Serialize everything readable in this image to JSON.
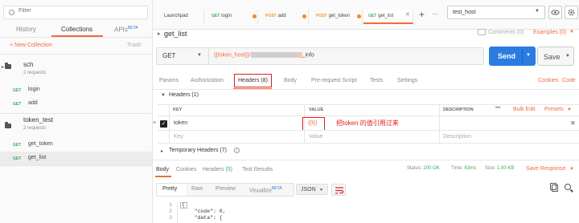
{
  "sidebar": {
    "filter_placeholder": "Filter",
    "tabs": [
      {
        "label": "History"
      },
      {
        "label": "Collections"
      },
      {
        "label": "APIs"
      }
    ],
    "apis_badge": "BETA",
    "new_collection": "+ New Collection",
    "trash": "Trash",
    "collections": [
      {
        "name": "sch",
        "count": "2 requests",
        "requests": [
          {
            "method": "GET",
            "name": "login"
          },
          {
            "method": "GET",
            "name": "add"
          }
        ]
      },
      {
        "name": "token_test",
        "count": "2 requests",
        "requests": [
          {
            "method": "GET",
            "name": "get_token"
          },
          {
            "method": "GET",
            "name": "get_list"
          }
        ]
      }
    ]
  },
  "tabs": [
    {
      "label": "Launchpad",
      "method": ""
    },
    {
      "label": "login",
      "method": "GET"
    },
    {
      "label": "add",
      "method": "POST"
    },
    {
      "label": "get_token",
      "method": "POST"
    },
    {
      "label": "get_list",
      "method": "GET"
    }
  ],
  "tab_add": "+",
  "tab_more": "···",
  "environment": "test_host",
  "request": {
    "name": "get_list",
    "comments": "Comments (0)",
    "examples": "Examples (0)",
    "method": "GET",
    "url_prefix": "{{token_host}}/",
    "url_suffix": "_info",
    "send": "Send",
    "save": "Save"
  },
  "req_tabs": {
    "params": "Params",
    "authorization": "Authorization",
    "headers": "Headers (8)",
    "body": "Body",
    "prerequest": "Pre-request Script",
    "tests": "Tests",
    "settings": "Settings",
    "cookies": "Cookies",
    "code": "Code"
  },
  "headers_section": {
    "title": "Headers (1)",
    "col_key": "KEY",
    "col_value": "VALUE",
    "col_description": "DESCRIPTION",
    "more": "•••",
    "bulk_edit": "Bulk Edit",
    "presets": "Presets",
    "row_key": "token",
    "row_value": "{{t}}",
    "annotation": "把token 的值引用过来",
    "key_placeholder": "Key",
    "value_placeholder": "Value",
    "desc_placeholder": "Description",
    "temp_headers": "Temporary Headers (7)"
  },
  "response": {
    "tabs": {
      "body": "Body",
      "cookies": "Cookies",
      "headers": "Headers",
      "headers_count": "(5)",
      "test_results": "Test Results"
    },
    "status_label": "Status:",
    "status_value": "200 OK",
    "time_label": "Time:",
    "time_value": "63ms",
    "size_label": "Size:",
    "size_value": "1.00 KB",
    "save_response": "Save Response",
    "views": {
      "pretty": "Pretty",
      "raw": "Raw",
      "preview": "Preview",
      "visualize": "Visualize",
      "visualize_badge": "BETA"
    },
    "format": "JSON",
    "lines": [
      {
        "n": "1",
        "text": "{"
      },
      {
        "n": "2",
        "text": "    \"code\": 0,"
      },
      {
        "n": "3",
        "text": "    \"data\": {"
      }
    ]
  },
  "colors": {
    "accent": "#f26b3a",
    "send": "#2a7ce2",
    "annotation": "#e02020",
    "get": "#3aab58",
    "post": "#e9a01c"
  }
}
